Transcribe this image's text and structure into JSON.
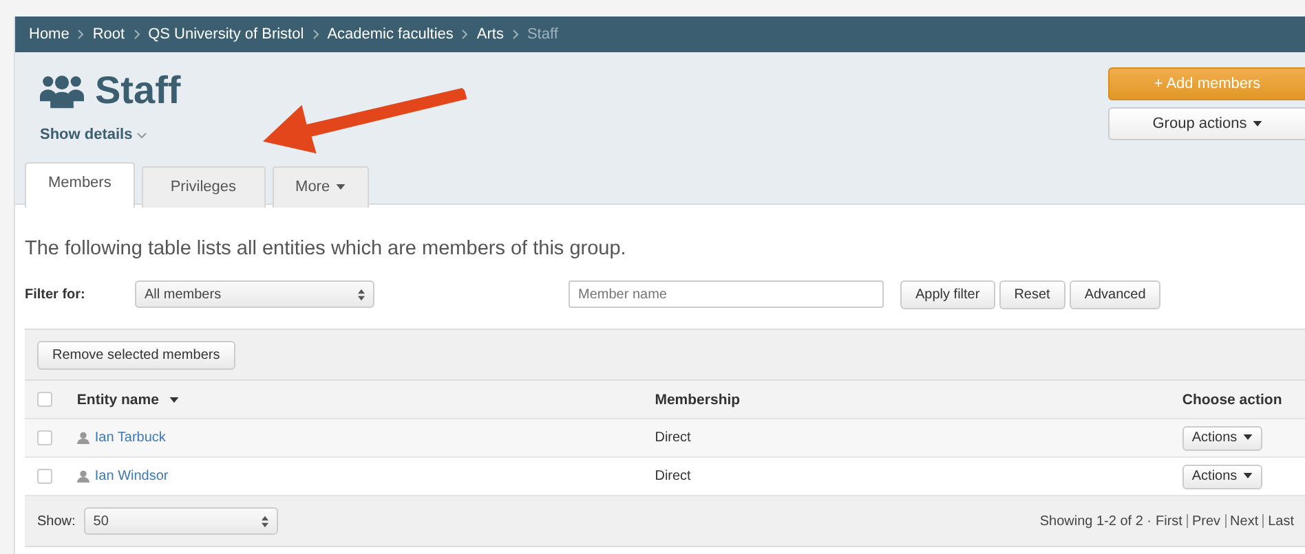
{
  "breadcrumb": [
    {
      "label": "Home",
      "current": false
    },
    {
      "label": "Root",
      "current": false
    },
    {
      "label": "QS University of Bristol",
      "current": false
    },
    {
      "label": "Academic faculties",
      "current": false
    },
    {
      "label": "Arts",
      "current": false
    },
    {
      "label": "Staff",
      "current": true
    }
  ],
  "title": "Staff",
  "show_details": "Show details",
  "header_buttons": [
    {
      "label": "+ Add members",
      "kind": "primary"
    },
    {
      "label": "Group actions",
      "kind": "dropdown"
    }
  ],
  "tabs": [
    {
      "label": "Members",
      "selected": true,
      "dropdown": false
    },
    {
      "label": "Privileges",
      "selected": false,
      "dropdown": false
    },
    {
      "label": "More",
      "selected": false,
      "dropdown": true
    }
  ],
  "intro": "The following table lists all entities which are members of this group.",
  "filter": {
    "label": "Filter for:",
    "select": "All members",
    "placeholder": "Member name",
    "buttons": [
      "Apply filter",
      "Reset",
      "Advanced"
    ]
  },
  "table": {
    "toolbar_button": "Remove selected members",
    "select_all_checked": false,
    "columns": [
      "Entity name",
      "Membership",
      "Choose action"
    ],
    "rows": [
      {
        "name": "Ian Tarbuck",
        "membership": "Direct",
        "action": "Actions",
        "checked": false
      },
      {
        "name": "Ian Windsor",
        "membership": "Direct",
        "action": "Actions",
        "checked": false
      }
    ],
    "footer": {
      "show_label": "Show:",
      "show_value": "50",
      "showing": "Showing 1-2 of 2 ·",
      "pages": [
        "First",
        "Prev",
        "Next",
        "Last"
      ]
    }
  }
}
